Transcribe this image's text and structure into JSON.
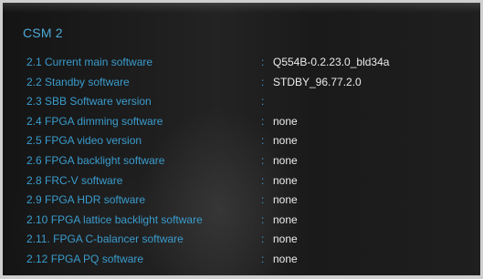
{
  "menu": {
    "title": "CSM 2",
    "separator": ":",
    "items": [
      {
        "label": "2.1 Current main software",
        "value": "Q554B-0.2.23.0_bld34a"
      },
      {
        "label": "2.2 Standby software",
        "value": "STDBY_96.77.2.0"
      },
      {
        "label": "2.3 SBB Software version",
        "value": ""
      },
      {
        "label": "2.4 FPGA dimming software",
        "value": "none"
      },
      {
        "label": "2.5 FPGA video version",
        "value": "none"
      },
      {
        "label": "2.6 FPGA backlight software",
        "value": "none"
      },
      {
        "label": "2.8 FRC-V software",
        "value": "none"
      },
      {
        "label": "2.9 FPGA HDR software",
        "value": "none"
      },
      {
        "label": "2.10 FPGA lattice backlight software",
        "value": "none"
      },
      {
        "label": "2.11. FPGA C-balancer software",
        "value": "none"
      },
      {
        "label": "2.12 FPGA PQ software",
        "value": "none"
      }
    ]
  }
}
